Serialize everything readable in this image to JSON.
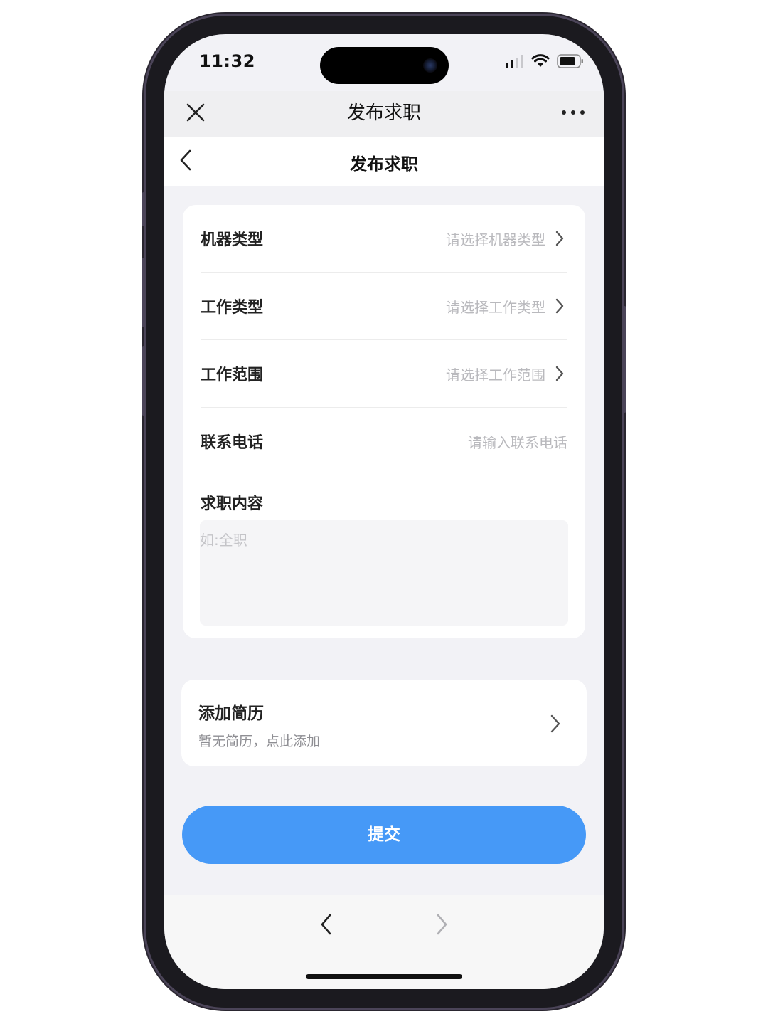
{
  "status_bar": {
    "time": "11:32",
    "icons": [
      "signal-icon",
      "wifi-icon",
      "battery-icon"
    ]
  },
  "top_nav": {
    "title": "发布求职",
    "close_icon": "close-icon",
    "more_icon": "more-icon"
  },
  "sub_nav": {
    "title": "发布求职",
    "back_icon": "chevron-left-icon"
  },
  "form": {
    "rows": [
      {
        "label": "机器类型",
        "placeholder": "请选择机器类型"
      },
      {
        "label": "工作类型",
        "placeholder": "请选择工作类型"
      },
      {
        "label": "工作范围",
        "placeholder": "请选择工作范围"
      },
      {
        "label": "联系电话",
        "placeholder": "请输入联系电话"
      }
    ],
    "content": {
      "label": "求职内容",
      "placeholder": "如:全职"
    }
  },
  "resume": {
    "title": "添加简历",
    "subtitle": "暂无简历，点此添加"
  },
  "submit": {
    "label": "提交"
  },
  "bottom_bar": {
    "back_icon": "chevron-left-icon",
    "forward_icon": "chevron-right-icon"
  },
  "colors": {
    "accent": "#4699f7",
    "page_bg": "#f2f2f6",
    "placeholder": "#b9b9bd"
  }
}
